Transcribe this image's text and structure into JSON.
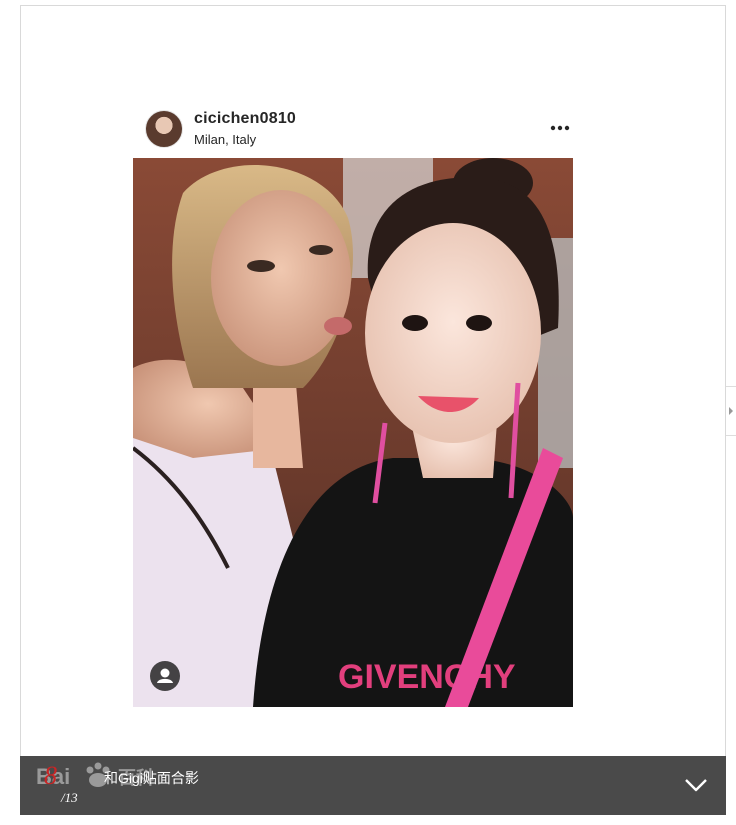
{
  "post": {
    "username": "cicichen0810",
    "location": "Milan, Italy",
    "more_icon": "more-horizontal-icon",
    "tag_icon": "user-tag-icon"
  },
  "gallery": {
    "current_index": "8",
    "total": "/13",
    "caption": "和Gigi贴面合影",
    "watermark": "Bai 百科",
    "collapse_icon": "chevron-down-icon",
    "next_icon": "chevron-right-icon"
  },
  "colors": {
    "caption_bar": "#4a4a4a",
    "page_current": "#c92525",
    "frame_border": "#d9d9d9",
    "text_dark": "#262626"
  }
}
